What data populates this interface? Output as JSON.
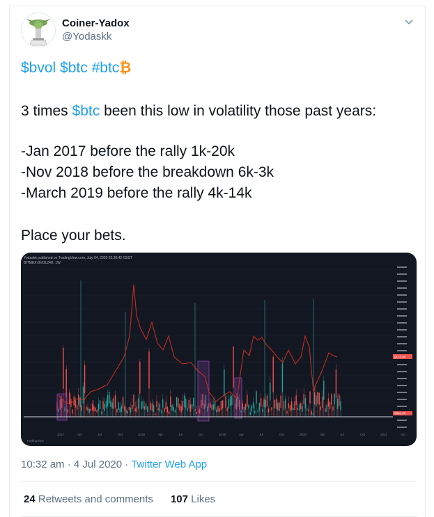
{
  "user": {
    "display_name": "Coiner-Yadox",
    "handle": "@Yodaskk"
  },
  "tweet": {
    "hashtags": [
      "$bvol",
      "$btc",
      "#btc"
    ],
    "btc_glyph": "₿",
    "line2_tag": "$btc",
    "line2_before": "3 times ",
    "line2_after": " been this low in volatility those past years:",
    "line3": "-Jan 2017 before the rally  1k-20k",
    "line4": "-Nov 2018 before the breakdown 6k-3k",
    "line5": "-March 2019 before the rally 4k-14k",
    "line6": "Place your bets."
  },
  "chart_image": {
    "header_text": "Yodaskk published on TradingView.com, July 04, 2020 22:20:42 CEST",
    "symbol_text": "BITMEX:BVOL24H, 1W",
    "x_labels": [
      "2017",
      "Apr",
      "Jul",
      "Oct",
      "2018",
      "Apr",
      "Jul",
      "Oct",
      "2019",
      "Apr",
      "Jul",
      "Oct",
      "2020",
      "Apr",
      "Jul",
      "Oct",
      "2021",
      "Apr"
    ],
    "watermark": "TradingView",
    "price_tag_red": "9173.00",
    "price_tag_small": "9092.00",
    "colors": {
      "background": "#131722",
      "vol_line": "#d0311f",
      "candle_up": "#26a69a",
      "candle_down": "#ef5350",
      "highlight": "#8e44ad"
    }
  },
  "meta": {
    "time": "10:32 am",
    "date": "4 Jul 2020",
    "separator": "·",
    "app": "Twitter Web App"
  },
  "stats": {
    "retweets_count": "24",
    "retweets_label": "Retweets and comments",
    "likes_count": "107",
    "likes_label": "Likes"
  }
}
